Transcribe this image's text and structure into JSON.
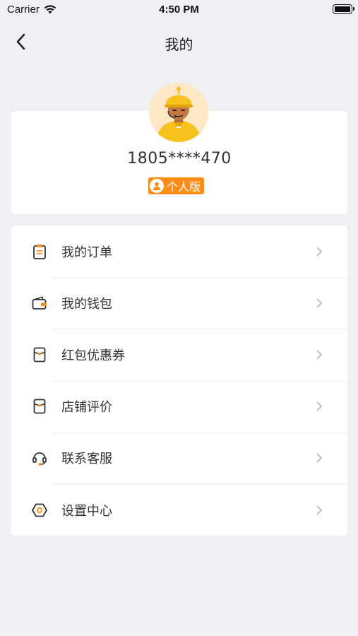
{
  "status_bar": {
    "carrier": "Carrier",
    "time": "4:50 PM"
  },
  "nav": {
    "title": "我的"
  },
  "profile": {
    "phone": "1805****470",
    "badge": "个人版"
  },
  "menu": {
    "items": [
      {
        "label": "我的订单",
        "icon": "order-clipboard-icon"
      },
      {
        "label": "我的钱包",
        "icon": "wallet-icon"
      },
      {
        "label": "红包优惠券",
        "icon": "red-envelope-icon"
      },
      {
        "label": "店铺评价",
        "icon": "store-review-icon"
      },
      {
        "label": "联系客服",
        "icon": "headset-icon"
      },
      {
        "label": "设置中心",
        "icon": "settings-hexagon-icon"
      }
    ]
  },
  "colors": {
    "accent": "#ff8d1a",
    "background": "#efeff4",
    "card": "#ffffff"
  }
}
